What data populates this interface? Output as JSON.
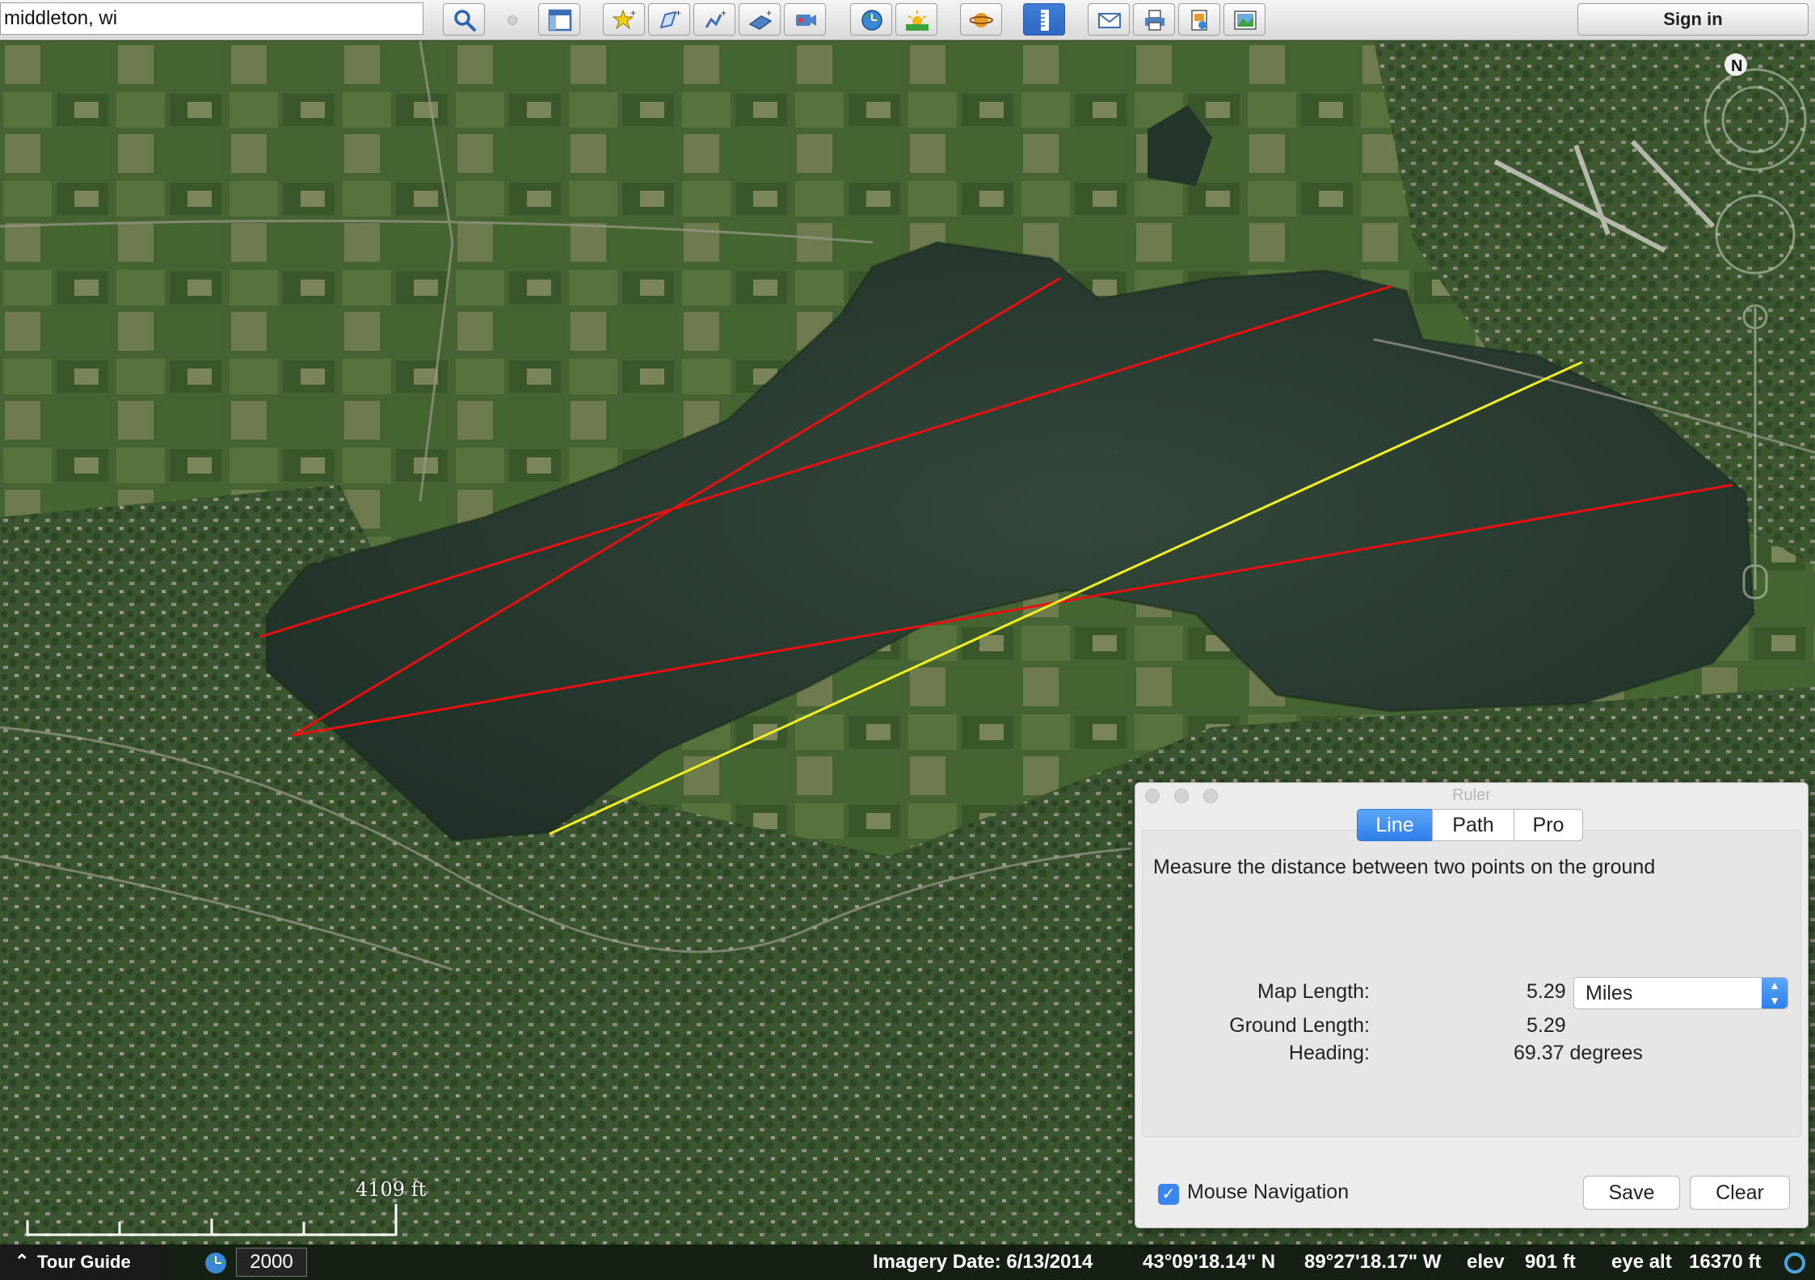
{
  "toolbar": {
    "search_value": "middleton, wi",
    "sign_in_label": "Sign in",
    "buttons": [
      "search-icon",
      "sidebar-icon",
      "placemark-icon",
      "polygon-icon",
      "path-icon",
      "image-overlay-icon",
      "record-tour-icon",
      "historical-imagery-icon",
      "sunlight-icon",
      "planet-icon",
      "ruler-icon",
      "email-icon",
      "print-icon",
      "save-image-icon",
      "view-in-maps-icon"
    ]
  },
  "map": {
    "scale_label": "4109 ft",
    "line_colors": {
      "measure": "#f5f01a",
      "overlay": "#e81010"
    }
  },
  "status": {
    "tour_guide_label": "Tour Guide",
    "historical_year": "2000",
    "imagery_date": "Imagery Date: 6/13/2014",
    "latitude": "43°09'18.14\" N",
    "longitude": "89°27'18.17\" W",
    "elev_label": "elev",
    "elev_value": "901 ft",
    "eye_alt_label": "eye alt",
    "eye_alt_value": "16370 ft"
  },
  "ruler": {
    "title": "Ruler",
    "tabs": [
      "Line",
      "Path",
      "Pro"
    ],
    "active_tab": "Line",
    "description": "Measure the distance between two points on the ground",
    "map_length_label": "Map Length:",
    "map_length_value": "5.29",
    "units": "Miles",
    "ground_length_label": "Ground Length:",
    "ground_length_value": "5.29",
    "heading_label": "Heading:",
    "heading_value": "69.37 degrees",
    "mouse_nav_label": "Mouse Navigation",
    "mouse_nav_checked": true,
    "save_label": "Save",
    "clear_label": "Clear"
  }
}
